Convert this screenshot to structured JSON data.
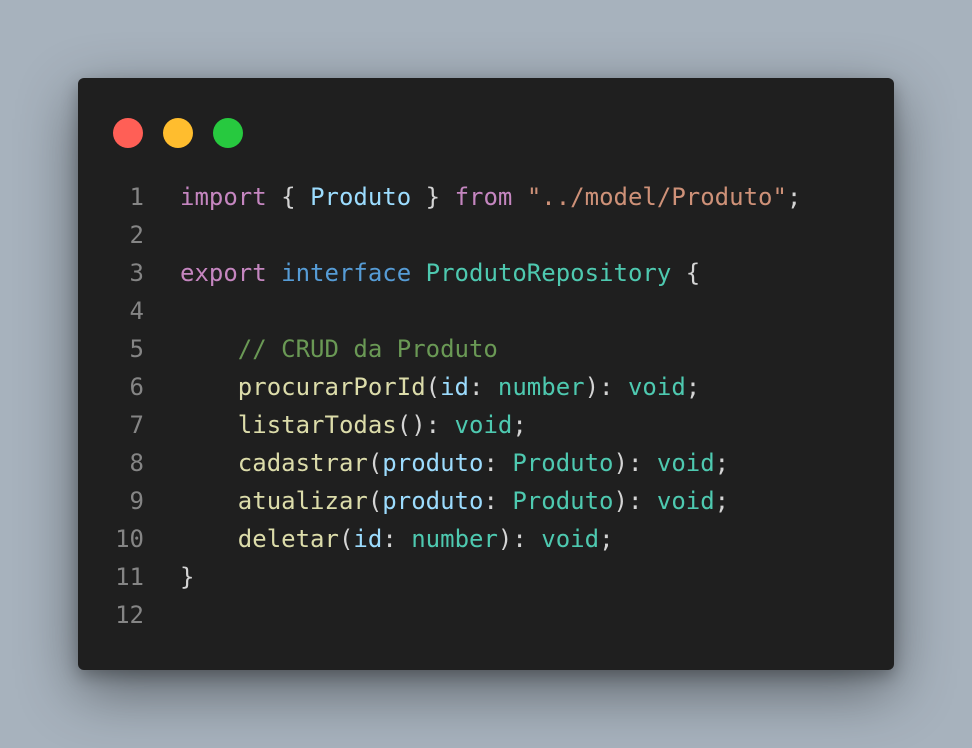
{
  "colors": {
    "background": "#a7b2bd",
    "window": "#1f1f1f",
    "line_number": "#858585",
    "default": "#d4d4d4",
    "keyword_control": "#c586c0",
    "keyword": "#569cd6",
    "type": "#4ec9b0",
    "variable": "#9cdcfe",
    "string": "#ce9178",
    "comment": "#6a9955",
    "function": "#dcdcaa"
  },
  "window_controls": [
    {
      "name": "close-dot",
      "color": "#ff5f56"
    },
    {
      "name": "minimize-dot",
      "color": "#ffbd2e"
    },
    {
      "name": "maximize-dot",
      "color": "#27c93f"
    }
  ],
  "code": {
    "lines": [
      {
        "number": "1",
        "tokens": [
          {
            "t": "import",
            "c": "keyword_control"
          },
          {
            "t": " { ",
            "c": "default"
          },
          {
            "t": "Produto",
            "c": "variable"
          },
          {
            "t": " } ",
            "c": "default"
          },
          {
            "t": "from",
            "c": "keyword_control"
          },
          {
            "t": " ",
            "c": "default"
          },
          {
            "t": "\"../model/Produto\"",
            "c": "string"
          },
          {
            "t": ";",
            "c": "default"
          }
        ]
      },
      {
        "number": "2",
        "tokens": []
      },
      {
        "number": "3",
        "tokens": [
          {
            "t": "export",
            "c": "keyword_control"
          },
          {
            "t": " ",
            "c": "default"
          },
          {
            "t": "interface",
            "c": "keyword"
          },
          {
            "t": " ",
            "c": "default"
          },
          {
            "t": "ProdutoRepository",
            "c": "type"
          },
          {
            "t": " {",
            "c": "default"
          }
        ]
      },
      {
        "number": "4",
        "tokens": []
      },
      {
        "number": "5",
        "tokens": [
          {
            "t": "    ",
            "c": "default"
          },
          {
            "t": "// CRUD da Produto",
            "c": "comment"
          }
        ]
      },
      {
        "number": "6",
        "tokens": [
          {
            "t": "    ",
            "c": "default"
          },
          {
            "t": "procurarPorId",
            "c": "function"
          },
          {
            "t": "(",
            "c": "default"
          },
          {
            "t": "id",
            "c": "variable"
          },
          {
            "t": ": ",
            "c": "default"
          },
          {
            "t": "number",
            "c": "type"
          },
          {
            "t": "): ",
            "c": "default"
          },
          {
            "t": "void",
            "c": "type"
          },
          {
            "t": ";",
            "c": "default"
          }
        ]
      },
      {
        "number": "7",
        "tokens": [
          {
            "t": "    ",
            "c": "default"
          },
          {
            "t": "listarTodas",
            "c": "function"
          },
          {
            "t": "(): ",
            "c": "default"
          },
          {
            "t": "void",
            "c": "type"
          },
          {
            "t": ";",
            "c": "default"
          }
        ]
      },
      {
        "number": "8",
        "tokens": [
          {
            "t": "    ",
            "c": "default"
          },
          {
            "t": "cadastrar",
            "c": "function"
          },
          {
            "t": "(",
            "c": "default"
          },
          {
            "t": "produto",
            "c": "variable"
          },
          {
            "t": ": ",
            "c": "default"
          },
          {
            "t": "Produto",
            "c": "type"
          },
          {
            "t": "): ",
            "c": "default"
          },
          {
            "t": "void",
            "c": "type"
          },
          {
            "t": ";",
            "c": "default"
          }
        ]
      },
      {
        "number": "9",
        "tokens": [
          {
            "t": "    ",
            "c": "default"
          },
          {
            "t": "atualizar",
            "c": "function"
          },
          {
            "t": "(",
            "c": "default"
          },
          {
            "t": "produto",
            "c": "variable"
          },
          {
            "t": ": ",
            "c": "default"
          },
          {
            "t": "Produto",
            "c": "type"
          },
          {
            "t": "): ",
            "c": "default"
          },
          {
            "t": "void",
            "c": "type"
          },
          {
            "t": ";",
            "c": "default"
          }
        ]
      },
      {
        "number": "10",
        "tokens": [
          {
            "t": "    ",
            "c": "default"
          },
          {
            "t": "deletar",
            "c": "function"
          },
          {
            "t": "(",
            "c": "default"
          },
          {
            "t": "id",
            "c": "variable"
          },
          {
            "t": ": ",
            "c": "default"
          },
          {
            "t": "number",
            "c": "type"
          },
          {
            "t": "): ",
            "c": "default"
          },
          {
            "t": "void",
            "c": "type"
          },
          {
            "t": ";",
            "c": "default"
          }
        ]
      },
      {
        "number": "11",
        "tokens": [
          {
            "t": "}",
            "c": "default"
          }
        ]
      },
      {
        "number": "12",
        "tokens": []
      }
    ]
  }
}
